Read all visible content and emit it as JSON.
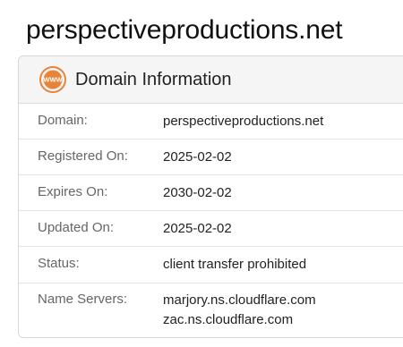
{
  "site_title": "perspectiveproductions.net",
  "card": {
    "title": "Domain Information",
    "icon": "www-icon",
    "icon_text": "WWW",
    "accent_color": "#e8833a",
    "rows": [
      {
        "label": "Domain:",
        "value": "perspectiveproductions.net"
      },
      {
        "label": "Registered On:",
        "value": "2025-02-02"
      },
      {
        "label": "Expires On:",
        "value": "2030-02-02"
      },
      {
        "label": "Updated On:",
        "value": "2025-02-02"
      },
      {
        "label": "Status:",
        "value": "client transfer prohibited"
      },
      {
        "label": "Name Servers:",
        "values": [
          "marjory.ns.cloudflare.com",
          "zac.ns.cloudflare.com"
        ]
      }
    ]
  }
}
